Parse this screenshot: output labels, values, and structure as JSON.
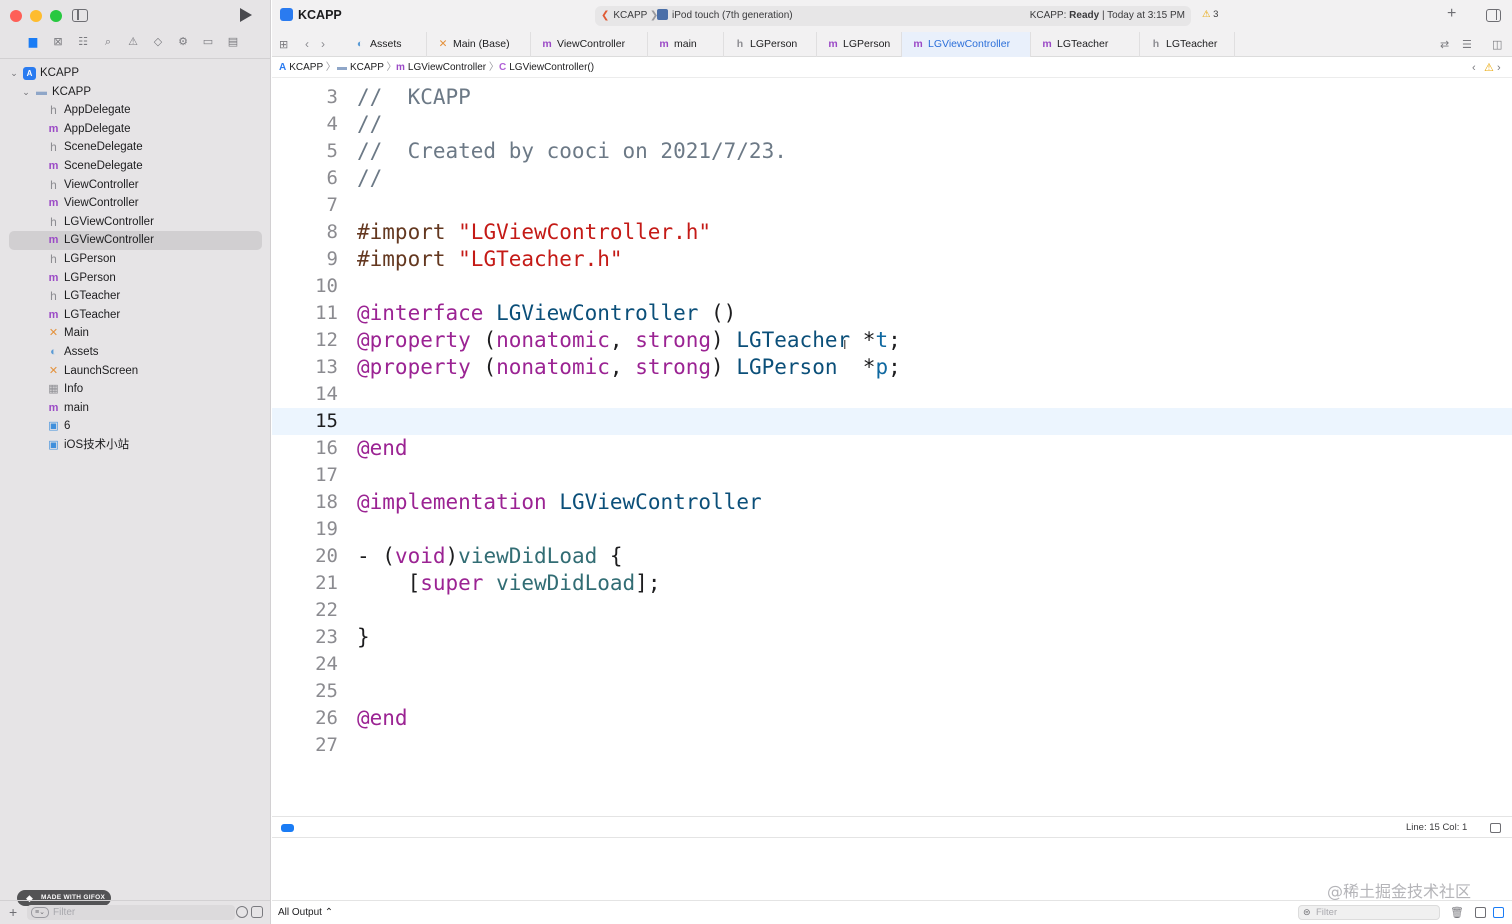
{
  "toolbar": {
    "project": "KCAPP",
    "scheme": "KCAPP",
    "device": "iPod touch (7th generation)",
    "status_prefix": "KCAPP:",
    "status_state": "Ready",
    "status_time": "| Today at 3:15 PM",
    "warnings": "3"
  },
  "tabs": [
    {
      "icon": "assets",
      "label": "Assets"
    },
    {
      "icon": "x",
      "label": "Main (Base)"
    },
    {
      "icon": "m",
      "label": "ViewController"
    },
    {
      "icon": "m",
      "label": "main"
    },
    {
      "icon": "h",
      "label": "LGPerson"
    },
    {
      "icon": "m",
      "label": "LGPerson"
    },
    {
      "icon": "m",
      "label": "LGViewController",
      "active": true
    },
    {
      "icon": "m",
      "label": "LGTeacher"
    },
    {
      "icon": "h",
      "label": "LGTeacher"
    }
  ],
  "breadcrumb": [
    "KCAPP",
    "KCAPP",
    "LGViewController",
    "LGViewController()"
  ],
  "navigator": {
    "items": [
      {
        "icon": "app",
        "label": "KCAPP",
        "level": 0,
        "expanded": true
      },
      {
        "icon": "folder",
        "label": "KCAPP",
        "level": 1,
        "expanded": true
      },
      {
        "icon": "h",
        "label": "AppDelegate",
        "level": 2
      },
      {
        "icon": "m",
        "label": "AppDelegate",
        "level": 2
      },
      {
        "icon": "h",
        "label": "SceneDelegate",
        "level": 2
      },
      {
        "icon": "m",
        "label": "SceneDelegate",
        "level": 2
      },
      {
        "icon": "h",
        "label": "ViewController",
        "level": 2
      },
      {
        "icon": "m",
        "label": "ViewController",
        "level": 2
      },
      {
        "icon": "h",
        "label": "LGViewController",
        "level": 2
      },
      {
        "icon": "m",
        "label": "LGViewController",
        "level": 2,
        "selected": true
      },
      {
        "icon": "h",
        "label": "LGPerson",
        "level": 2
      },
      {
        "icon": "m",
        "label": "LGPerson",
        "level": 2
      },
      {
        "icon": "h",
        "label": "LGTeacher",
        "level": 2
      },
      {
        "icon": "m",
        "label": "LGTeacher",
        "level": 2
      },
      {
        "icon": "x",
        "label": "Main",
        "level": 2
      },
      {
        "icon": "assets",
        "label": "Assets",
        "level": 2
      },
      {
        "icon": "x",
        "label": "LaunchScreen",
        "level": 2
      },
      {
        "icon": "grid",
        "label": "Info",
        "level": 2
      },
      {
        "icon": "m",
        "label": "main",
        "level": 2
      },
      {
        "icon": "img",
        "label": "6",
        "level": 2
      },
      {
        "icon": "img",
        "label": "iOS技术小站",
        "level": 2
      }
    ],
    "filter_placeholder": "Filter"
  },
  "editor": {
    "current_line": 15,
    "lines": [
      {
        "n": 3,
        "tokens": [
          [
            "c-cm",
            "//  KCAPP"
          ]
        ]
      },
      {
        "n": 4,
        "tokens": [
          [
            "c-cm",
            "//"
          ]
        ]
      },
      {
        "n": 5,
        "tokens": [
          [
            "c-cm",
            "//  Created by cooci on 2021/7/23."
          ]
        ]
      },
      {
        "n": 6,
        "tokens": [
          [
            "c-cm",
            "//"
          ]
        ]
      },
      {
        "n": 7,
        "tokens": []
      },
      {
        "n": 8,
        "tokens": [
          [
            "c-pp",
            "#import "
          ],
          [
            "c-str",
            "\"LGViewController.h\""
          ]
        ]
      },
      {
        "n": 9,
        "tokens": [
          [
            "c-pp",
            "#import "
          ],
          [
            "c-str",
            "\"LGTeacher.h\""
          ]
        ]
      },
      {
        "n": 10,
        "tokens": []
      },
      {
        "n": 11,
        "tokens": [
          [
            "c-kw",
            "@interface"
          ],
          [
            "",
            " "
          ],
          [
            "c-cls",
            "LGViewController"
          ],
          [
            "",
            " ()"
          ]
        ]
      },
      {
        "n": 12,
        "tokens": [
          [
            "c-kw",
            "@property"
          ],
          [
            "",
            " ("
          ],
          [
            "c-kw",
            "nonatomic"
          ],
          [
            "",
            ", "
          ],
          [
            "c-kw",
            "strong"
          ],
          [
            "",
            ") "
          ],
          [
            "c-cls",
            "LGTeacher"
          ],
          [
            "",
            " *"
          ],
          [
            "c-var",
            "t"
          ],
          [
            "",
            ";"
          ]
        ]
      },
      {
        "n": 13,
        "tokens": [
          [
            "c-kw",
            "@property"
          ],
          [
            "",
            " ("
          ],
          [
            "c-kw",
            "nonatomic"
          ],
          [
            "",
            ", "
          ],
          [
            "c-kw",
            "strong"
          ],
          [
            "",
            ") "
          ],
          [
            "c-cls",
            "LGPerson"
          ],
          [
            "",
            "  *"
          ],
          [
            "c-var",
            "p"
          ],
          [
            "",
            ";"
          ]
        ]
      },
      {
        "n": 14,
        "tokens": []
      },
      {
        "n": 15,
        "tokens": []
      },
      {
        "n": 16,
        "tokens": [
          [
            "c-kw",
            "@end"
          ]
        ]
      },
      {
        "n": 17,
        "tokens": []
      },
      {
        "n": 18,
        "tokens": [
          [
            "c-kw",
            "@implementation"
          ],
          [
            "",
            " "
          ],
          [
            "c-cls",
            "LGViewController"
          ]
        ]
      },
      {
        "n": 19,
        "tokens": []
      },
      {
        "n": 20,
        "tokens": [
          [
            "",
            "- ("
          ],
          [
            "c-kw",
            "void"
          ],
          [
            "",
            ")"
          ],
          [
            "c-fn",
            "viewDidLoad"
          ],
          [
            "",
            " {"
          ]
        ]
      },
      {
        "n": 21,
        "tokens": [
          [
            "",
            "    ["
          ],
          [
            "c-kw",
            "super"
          ],
          [
            "",
            " "
          ],
          [
            "c-fn",
            "viewDidLoad"
          ],
          [
            "",
            "];"
          ]
        ]
      },
      {
        "n": 22,
        "tokens": []
      },
      {
        "n": 23,
        "tokens": [
          [
            "",
            "}"
          ]
        ]
      },
      {
        "n": 24,
        "tokens": []
      },
      {
        "n": 25,
        "tokens": []
      },
      {
        "n": 26,
        "tokens": [
          [
            "c-kw",
            "@end"
          ]
        ]
      },
      {
        "n": 27,
        "tokens": []
      }
    ]
  },
  "status_bar": {
    "position": "Line: 15  Col: 1"
  },
  "console": {
    "output_selector": "All Output ⌃",
    "filter_placeholder": "Filter"
  },
  "gifox_badge": "MADE WITH GIFOX",
  "watermark": "@稀土掘金技术社区"
}
